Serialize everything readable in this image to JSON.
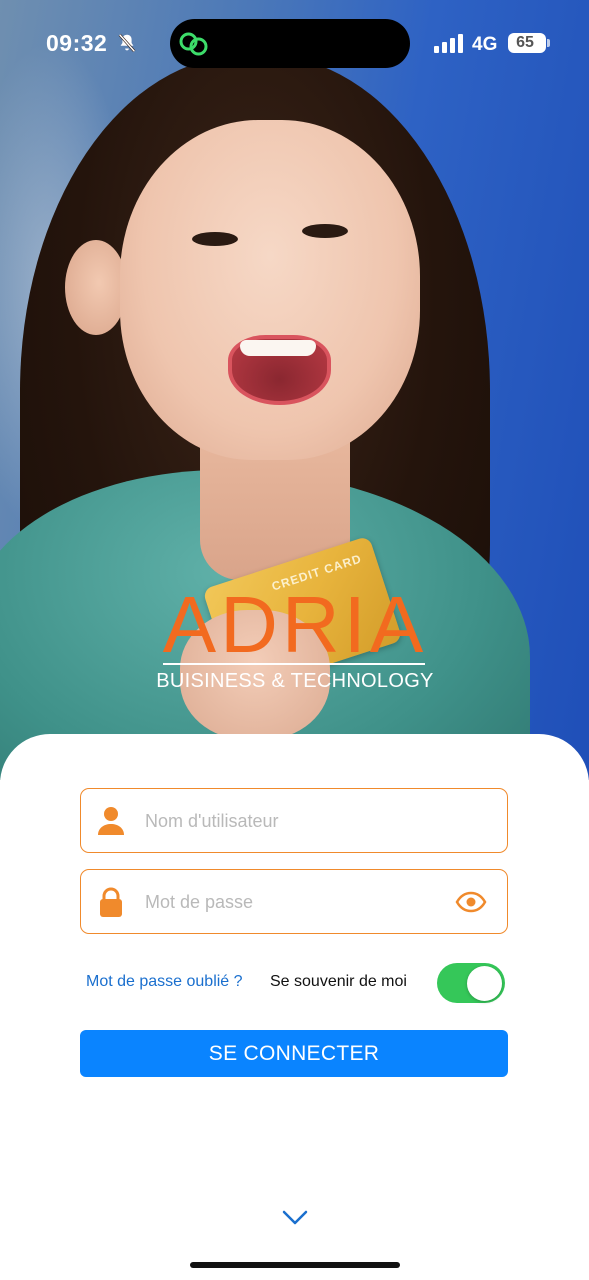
{
  "status_bar": {
    "time": "09:32",
    "network": "4G",
    "battery": "65"
  },
  "logo": {
    "title": "ADRIA",
    "subtitle": "BUISINESS & TECHNOLOGY",
    "brand_color": "#f26a1f"
  },
  "hero": {
    "card_text": "CREDIT CARD"
  },
  "login_form": {
    "username": {
      "placeholder": "Nom d'utilisateur",
      "value": "",
      "icon": "user-icon"
    },
    "password": {
      "placeholder": "Mot de passe",
      "value": "",
      "icon": "lock-icon",
      "toggle_icon": "eye-icon"
    },
    "forgot_link": "Mot de passe oublié ?",
    "remember_label": "Se souvenir de moi",
    "remember_enabled": true,
    "submit_label": "SE CONNECTER"
  },
  "colors": {
    "accent": "#f08a2c",
    "primary_button": "#0a84ff",
    "link": "#1a6fce",
    "toggle_on": "#35c759"
  }
}
